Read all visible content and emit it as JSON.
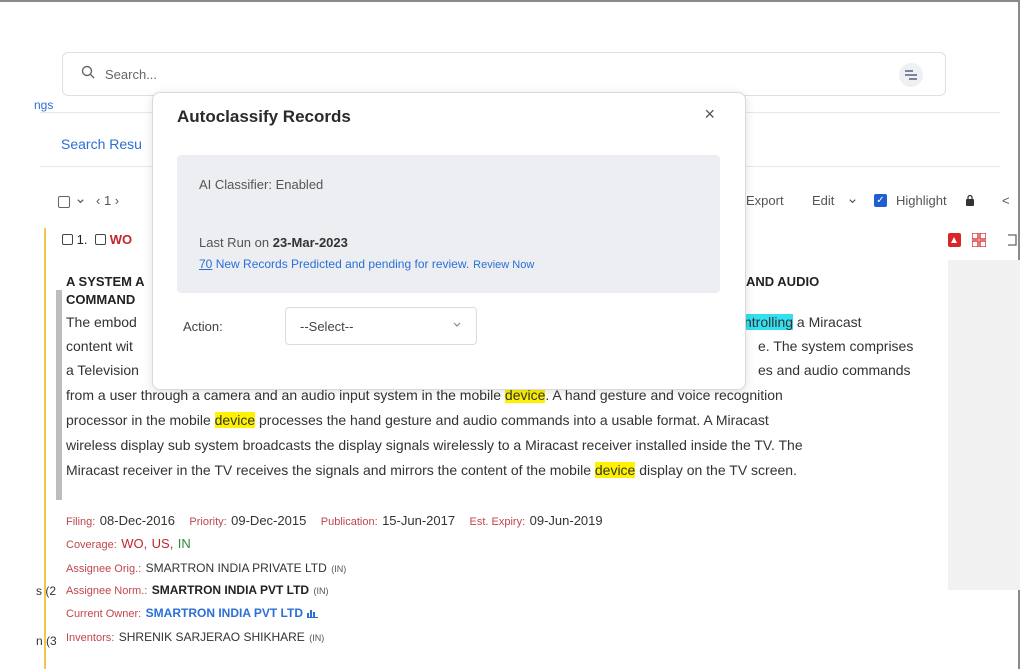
{
  "left_cut": {
    "settings_fragment": "ngs",
    "facet_a": "s (2",
    "facet_b": "n (3"
  },
  "search": {
    "placeholder": "Search..."
  },
  "results": {
    "link_fragment": "Search Resu"
  },
  "toolbar": {
    "pager_fragment": "‹ 1 ›",
    "export_label": "Export",
    "edit_label": "Edit",
    "highlight_label": "Highlight",
    "share_fragment": "<"
  },
  "record": {
    "number": "1.",
    "pub_fragment": "WO",
    "title_left_1": "A SYSTEM A",
    "title_left_2": "COMMAND",
    "title_right": "AND AUDIO",
    "abstract": {
      "line1_a": "The embod",
      "line1_hl": "ntrolling",
      "line1_b": " a Miracast",
      "line2_a": "content wit",
      "line2_b": "e. The system comprises",
      "line3_a": "a Television",
      "line3_b": "es and audio commands",
      "line4_a": "from a user through a camera and an audio input system in the mobile ",
      "line4_hl": "device",
      "line4_b": ". A hand gesture and voice recognition",
      "line5_a": "processor in the mobile ",
      "line5_hl": "device",
      "line5_b": " processes the hand gesture and audio commands into a usable format. A Miracast",
      "line6": "wireless display sub system broadcasts the display signals wirelessly to a Miracast receiver installed inside the TV. The",
      "line7_a": "Miracast receiver in the TV receives the signals and mirrors the content of the mobile ",
      "line7_hl": "device",
      "line7_b": " display on the TV screen."
    },
    "dates": {
      "filing_label": "Filing:",
      "filing": "08-Dec-2016",
      "priority_label": "Priority:",
      "priority": "09-Dec-2015",
      "publication_label": "Publication:",
      "publication": "15-Jun-2017",
      "expiry_label": "Est. Expiry:",
      "expiry": "09-Jun-2019"
    },
    "coverage_label": "Coverage:",
    "coverage": {
      "wo": "WO,",
      "us": "US,",
      "in": "IN"
    },
    "assignee_orig_label": "Assignee Orig.:",
    "assignee_orig": "SMARTRON INDIA PRIVATE LTD",
    "assignee_orig_cc": "(IN)",
    "assignee_norm_label": "Assignee Norm.:",
    "assignee_norm": "SMARTRON INDIA PVT LTD",
    "assignee_norm_cc": "(IN)",
    "current_owner_label": "Current Owner:",
    "current_owner": "SMARTRON INDIA PVT LTD",
    "inventors_label": "Inventors:",
    "inventors": "SHRENIK SARJERAO SHIKHARE",
    "inventors_cc": "(IN)"
  },
  "modal": {
    "title": "Autoclassify Records",
    "close": "×",
    "ai_status": "AI Classifier: Enabled",
    "last_run_prefix": "Last Run on ",
    "last_run_date": "23-Mar-2023",
    "predicted_count": "70",
    "predicted_text": " New Records Predicted and pending for review.",
    "review_now": "Review Now",
    "action_label": "Action:",
    "action_selected": "--Select--"
  },
  "colors": {
    "accent_blue": "#2b6fd6",
    "highlight_yellow": "#fff200",
    "highlight_cyan": "#33e0f0",
    "label_red": "#c0464d"
  }
}
